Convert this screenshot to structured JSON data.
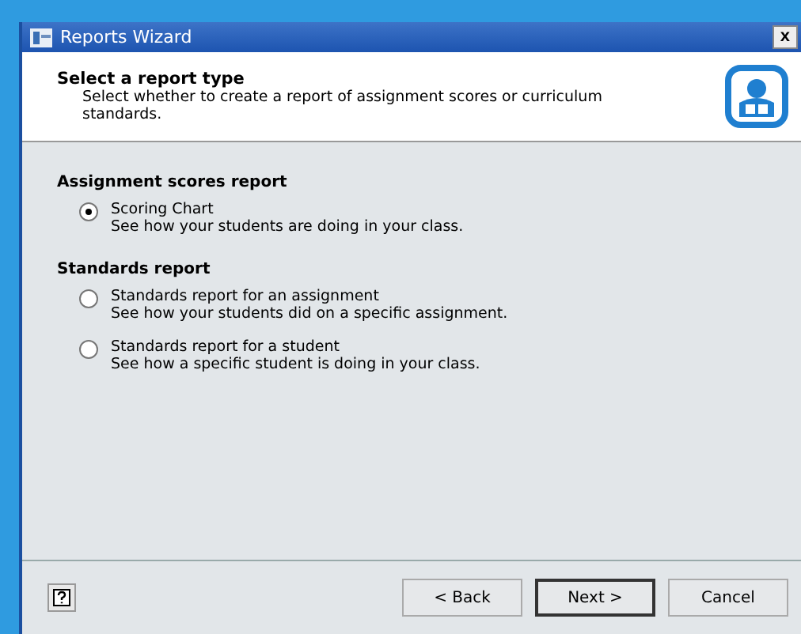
{
  "window": {
    "title": "Reports Wizard",
    "close": "x"
  },
  "header": {
    "title": "Select a report type",
    "description": "Select whether to create a report of assignment scores or curriculum standards."
  },
  "groups": [
    {
      "title": "Assignment scores report",
      "options": [
        {
          "label": "Scoring Chart",
          "description": "See how your students are doing in your class.",
          "selected": true
        }
      ]
    },
    {
      "title": "Standards report",
      "options": [
        {
          "label": "Standards report for an assignment",
          "description": "See how your students did on a specific assignment.",
          "selected": false
        },
        {
          "label": "Standards report for a student",
          "description": "See how a specific student is doing in your class.",
          "selected": false
        }
      ]
    }
  ],
  "buttons": [
    {
      "label": "< Back",
      "default": false
    },
    {
      "label": "Next >",
      "default": true
    },
    {
      "label": "Cancel",
      "default": false
    }
  ]
}
